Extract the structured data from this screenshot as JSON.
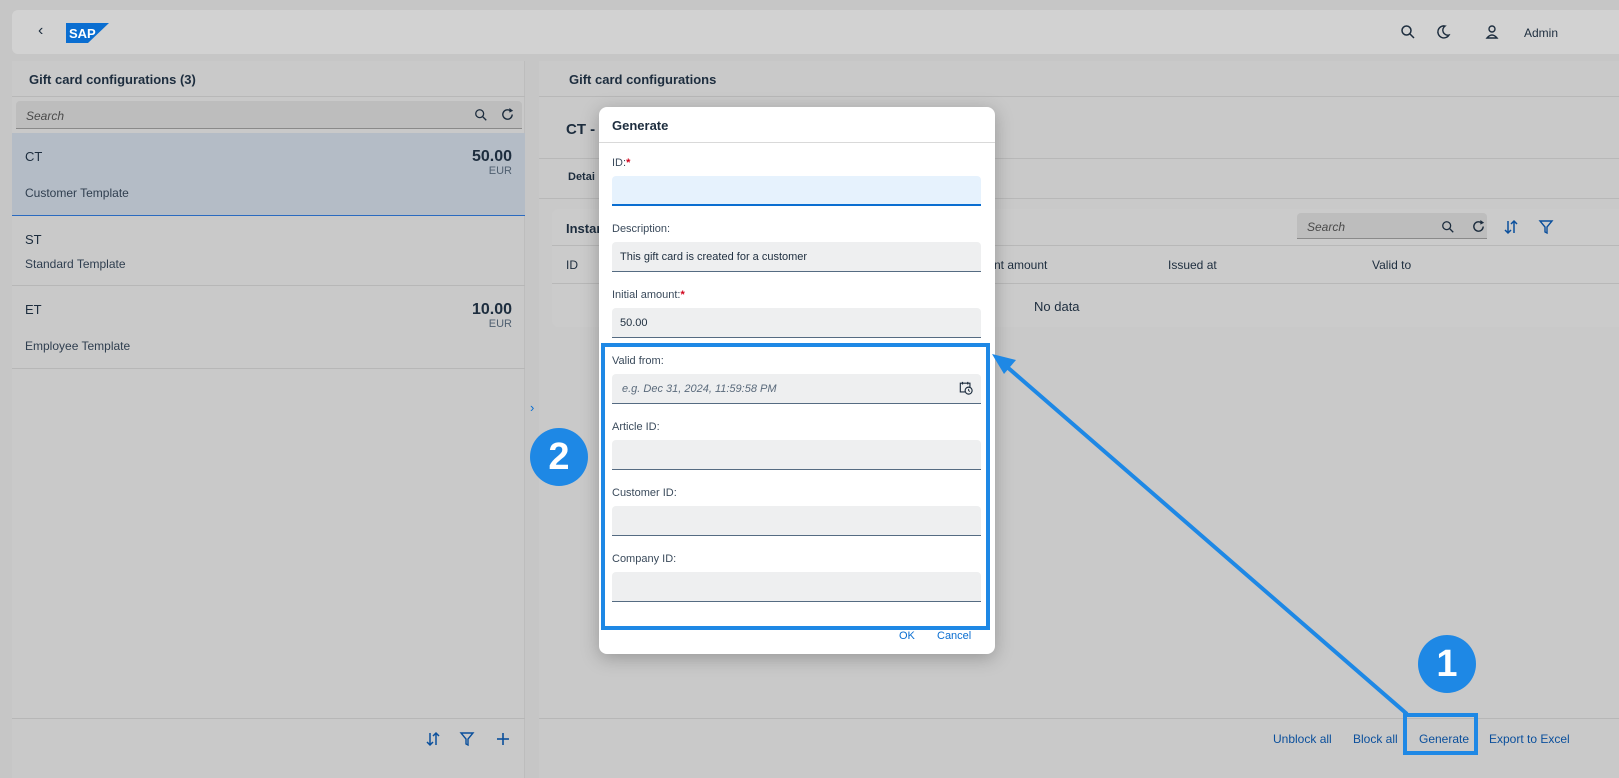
{
  "shell": {
    "back_icon": "chevron-left-icon",
    "logo_text": "SAP",
    "user_label": "Admin",
    "colors": {
      "logo_blue": "#0a6ed1"
    }
  },
  "left": {
    "title": "Gift card configurations (3)",
    "search_placeholder": "Search",
    "items": [
      {
        "code": "CT",
        "description": "Customer Template",
        "amount": "50.00",
        "currency": "EUR"
      },
      {
        "code": "ST",
        "description": "Standard Template"
      },
      {
        "code": "ET",
        "description": "Employee Template",
        "amount": "10.00",
        "currency": "EUR"
      }
    ]
  },
  "right": {
    "title": "Gift card configurations",
    "object_title": "CT -",
    "tab_label": "Detai",
    "table": {
      "title": "Instar",
      "search_placeholder": "Search",
      "columns": [
        "ID",
        "nt amount",
        "Issued at",
        "Valid to"
      ],
      "empty_text": "No data"
    },
    "footer_buttons": [
      "Unblock all",
      "Block all",
      "Generate",
      "Export to Excel"
    ]
  },
  "dialog": {
    "title": "Generate",
    "fields": [
      {
        "label": "ID:",
        "required": true,
        "value": ""
      },
      {
        "label": "Description:",
        "required": false,
        "value": "This gift card is created for a customer"
      },
      {
        "label": "Initial amount:",
        "required": true,
        "value": "50.00"
      },
      {
        "label": "Valid from:",
        "required": false,
        "value": "",
        "placeholder": "e.g. Dec 31, 2024, 11:59:58 PM"
      },
      {
        "label": "Article ID:",
        "required": false,
        "value": ""
      },
      {
        "label": "Customer ID:",
        "required": false,
        "value": ""
      },
      {
        "label": "Company ID:",
        "required": false,
        "value": ""
      }
    ],
    "required_marker": "*",
    "ok_label": "OK",
    "cancel_label": "Cancel"
  },
  "annotations": {
    "badge_1": "1",
    "badge_2": "2",
    "color": "#1e88e5"
  }
}
